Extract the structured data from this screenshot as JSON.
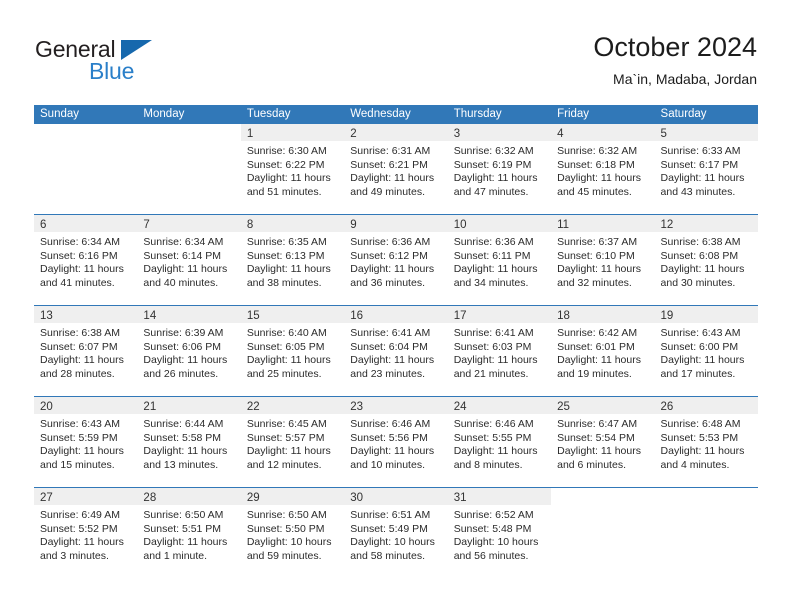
{
  "branding": {
    "logo_text_primary": "General",
    "logo_text_secondary": "Blue",
    "logo_triangle_color": "#1668ad",
    "logo_blue_color": "#2a7fc9"
  },
  "header": {
    "title": "October 2024",
    "subtitle": "Ma`in, Madaba, Jordan"
  },
  "theme": {
    "header_blue": "#3178b8",
    "daynum_band_gray": "#efefef",
    "text_color": "#2b2b2b"
  },
  "calendar": {
    "weekdays": [
      "Sunday",
      "Monday",
      "Tuesday",
      "Wednesday",
      "Thursday",
      "Friday",
      "Saturday"
    ],
    "weeks": [
      [
        {
          "day": "",
          "lines": []
        },
        {
          "day": "",
          "lines": []
        },
        {
          "day": "1",
          "lines": [
            "Sunrise: 6:30 AM",
            "Sunset: 6:22 PM",
            "Daylight: 11 hours",
            "and 51 minutes."
          ]
        },
        {
          "day": "2",
          "lines": [
            "Sunrise: 6:31 AM",
            "Sunset: 6:21 PM",
            "Daylight: 11 hours",
            "and 49 minutes."
          ]
        },
        {
          "day": "3",
          "lines": [
            "Sunrise: 6:32 AM",
            "Sunset: 6:19 PM",
            "Daylight: 11 hours",
            "and 47 minutes."
          ]
        },
        {
          "day": "4",
          "lines": [
            "Sunrise: 6:32 AM",
            "Sunset: 6:18 PM",
            "Daylight: 11 hours",
            "and 45 minutes."
          ]
        },
        {
          "day": "5",
          "lines": [
            "Sunrise: 6:33 AM",
            "Sunset: 6:17 PM",
            "Daylight: 11 hours",
            "and 43 minutes."
          ]
        }
      ],
      [
        {
          "day": "6",
          "lines": [
            "Sunrise: 6:34 AM",
            "Sunset: 6:16 PM",
            "Daylight: 11 hours",
            "and 41 minutes."
          ]
        },
        {
          "day": "7",
          "lines": [
            "Sunrise: 6:34 AM",
            "Sunset: 6:14 PM",
            "Daylight: 11 hours",
            "and 40 minutes."
          ]
        },
        {
          "day": "8",
          "lines": [
            "Sunrise: 6:35 AM",
            "Sunset: 6:13 PM",
            "Daylight: 11 hours",
            "and 38 minutes."
          ]
        },
        {
          "day": "9",
          "lines": [
            "Sunrise: 6:36 AM",
            "Sunset: 6:12 PM",
            "Daylight: 11 hours",
            "and 36 minutes."
          ]
        },
        {
          "day": "10",
          "lines": [
            "Sunrise: 6:36 AM",
            "Sunset: 6:11 PM",
            "Daylight: 11 hours",
            "and 34 minutes."
          ]
        },
        {
          "day": "11",
          "lines": [
            "Sunrise: 6:37 AM",
            "Sunset: 6:10 PM",
            "Daylight: 11 hours",
            "and 32 minutes."
          ]
        },
        {
          "day": "12",
          "lines": [
            "Sunrise: 6:38 AM",
            "Sunset: 6:08 PM",
            "Daylight: 11 hours",
            "and 30 minutes."
          ]
        }
      ],
      [
        {
          "day": "13",
          "lines": [
            "Sunrise: 6:38 AM",
            "Sunset: 6:07 PM",
            "Daylight: 11 hours",
            "and 28 minutes."
          ]
        },
        {
          "day": "14",
          "lines": [
            "Sunrise: 6:39 AM",
            "Sunset: 6:06 PM",
            "Daylight: 11 hours",
            "and 26 minutes."
          ]
        },
        {
          "day": "15",
          "lines": [
            "Sunrise: 6:40 AM",
            "Sunset: 6:05 PM",
            "Daylight: 11 hours",
            "and 25 minutes."
          ]
        },
        {
          "day": "16",
          "lines": [
            "Sunrise: 6:41 AM",
            "Sunset: 6:04 PM",
            "Daylight: 11 hours",
            "and 23 minutes."
          ]
        },
        {
          "day": "17",
          "lines": [
            "Sunrise: 6:41 AM",
            "Sunset: 6:03 PM",
            "Daylight: 11 hours",
            "and 21 minutes."
          ]
        },
        {
          "day": "18",
          "lines": [
            "Sunrise: 6:42 AM",
            "Sunset: 6:01 PM",
            "Daylight: 11 hours",
            "and 19 minutes."
          ]
        },
        {
          "day": "19",
          "lines": [
            "Sunrise: 6:43 AM",
            "Sunset: 6:00 PM",
            "Daylight: 11 hours",
            "and 17 minutes."
          ]
        }
      ],
      [
        {
          "day": "20",
          "lines": [
            "Sunrise: 6:43 AM",
            "Sunset: 5:59 PM",
            "Daylight: 11 hours",
            "and 15 minutes."
          ]
        },
        {
          "day": "21",
          "lines": [
            "Sunrise: 6:44 AM",
            "Sunset: 5:58 PM",
            "Daylight: 11 hours",
            "and 13 minutes."
          ]
        },
        {
          "day": "22",
          "lines": [
            "Sunrise: 6:45 AM",
            "Sunset: 5:57 PM",
            "Daylight: 11 hours",
            "and 12 minutes."
          ]
        },
        {
          "day": "23",
          "lines": [
            "Sunrise: 6:46 AM",
            "Sunset: 5:56 PM",
            "Daylight: 11 hours",
            "and 10 minutes."
          ]
        },
        {
          "day": "24",
          "lines": [
            "Sunrise: 6:46 AM",
            "Sunset: 5:55 PM",
            "Daylight: 11 hours",
            "and 8 minutes."
          ]
        },
        {
          "day": "25",
          "lines": [
            "Sunrise: 6:47 AM",
            "Sunset: 5:54 PM",
            "Daylight: 11 hours",
            "and 6 minutes."
          ]
        },
        {
          "day": "26",
          "lines": [
            "Sunrise: 6:48 AM",
            "Sunset: 5:53 PM",
            "Daylight: 11 hours",
            "and 4 minutes."
          ]
        }
      ],
      [
        {
          "day": "27",
          "lines": [
            "Sunrise: 6:49 AM",
            "Sunset: 5:52 PM",
            "Daylight: 11 hours",
            "and 3 minutes."
          ]
        },
        {
          "day": "28",
          "lines": [
            "Sunrise: 6:50 AM",
            "Sunset: 5:51 PM",
            "Daylight: 11 hours",
            "and 1 minute."
          ]
        },
        {
          "day": "29",
          "lines": [
            "Sunrise: 6:50 AM",
            "Sunset: 5:50 PM",
            "Daylight: 10 hours",
            "and 59 minutes."
          ]
        },
        {
          "day": "30",
          "lines": [
            "Sunrise: 6:51 AM",
            "Sunset: 5:49 PM",
            "Daylight: 10 hours",
            "and 58 minutes."
          ]
        },
        {
          "day": "31",
          "lines": [
            "Sunrise: 6:52 AM",
            "Sunset: 5:48 PM",
            "Daylight: 10 hours",
            "and 56 minutes."
          ]
        },
        {
          "day": "",
          "lines": []
        },
        {
          "day": "",
          "lines": []
        }
      ]
    ]
  }
}
